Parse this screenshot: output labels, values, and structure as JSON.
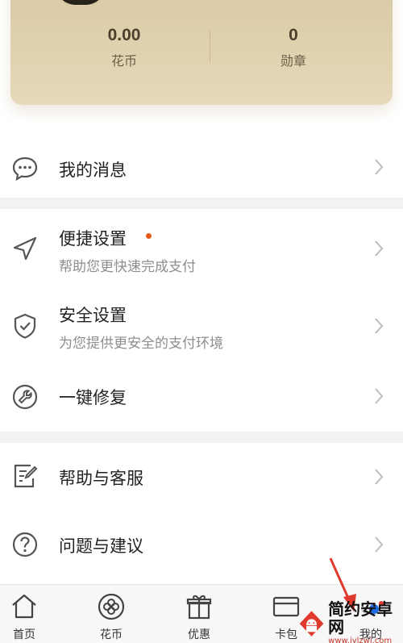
{
  "account": {
    "flower_coin_value": "0.00",
    "flower_coin_label": "花币",
    "medal_value": "0",
    "medal_label": "勋章"
  },
  "menu": {
    "messages": {
      "title": "我的消息"
    },
    "quick_settings": {
      "title": "便捷设置",
      "subtitle": "帮助您更快速完成支付",
      "has_dot": true
    },
    "security_settings": {
      "title": "安全设置",
      "subtitle": "为您提供更安全的支付环境"
    },
    "one_click_repair": {
      "title": "一键修复"
    },
    "help_service": {
      "title": "帮助与客服"
    },
    "feedback": {
      "title": "问题与建议"
    }
  },
  "bottom_nav": [
    {
      "label": "首页",
      "icon": "home-icon"
    },
    {
      "label": "花币",
      "icon": "flower-coin-icon"
    },
    {
      "label": "优惠",
      "icon": "gift-icon"
    },
    {
      "label": "卡包",
      "icon": "card-icon"
    },
    {
      "label": "我的",
      "icon": "profile-icon"
    }
  ],
  "watermark": {
    "title": "简约安卓网",
    "url": "www.jylzwj.com"
  },
  "colors": {
    "card_gold": "#ddceab",
    "dot_red": "#e85a1c",
    "active_blue": "#1e6fe6",
    "arrow_red": "#e03a2e"
  }
}
